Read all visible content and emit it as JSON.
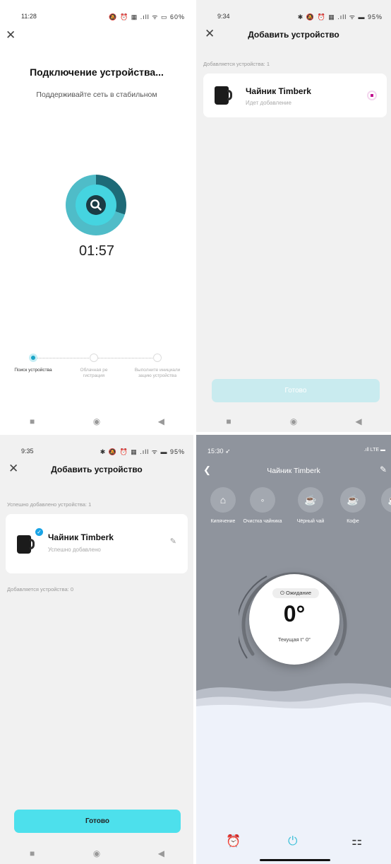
{
  "panel1": {
    "time": "11:28",
    "status_icons": "🔕 ⏰ ▦ .ıll ᯤ ▭ 60%",
    "title": "Подключение устройства...",
    "subtitle": "Поддерживайте сеть в стабильном",
    "timer": "01:57",
    "steps": [
      {
        "label": "Поиск устройства",
        "active": true
      },
      {
        "label": "Облачная ре гистрация",
        "active": false
      },
      {
        "label": "Выполните инициали зацию устройства",
        "active": false
      }
    ],
    "nav": [
      "■",
      "◉",
      "◀"
    ]
  },
  "panel2": {
    "time": "9:34",
    "status_icons": "✱ 🔕 ⏰ ▦ .ıll ᯤ ▬ 95%",
    "header": "Добавить устройство",
    "adding_label": "Добавляется устройства: 1",
    "device_name": "Чайник Timberk",
    "device_state": "Идет добавление",
    "done_button": "Готово",
    "nav": [
      "■",
      "◉",
      "◀"
    ]
  },
  "panel3": {
    "time": "9:35",
    "status_icons": "✱ 🔕 ⏰ ▦ .ıll ᯤ ▬ 95%",
    "header": "Добавить устройство",
    "success_label": "Успешно добавлено устройства: 1",
    "device_name": "Чайник Timberk",
    "device_state": "Успешно добавлено",
    "adding_label": "Добавляется устройства: 0",
    "done_button": "Готово",
    "nav": [
      "■",
      "◉",
      "◀"
    ]
  },
  "panel4": {
    "time": "15:30 ➶",
    "status_icons": ".ıll LTE ▬",
    "device_name": "Чайник Timberk",
    "modes": [
      {
        "label": "Кипячение",
        "icon": "kettle-icon",
        "glyph": "⌂"
      },
      {
        "label": "Очистка чайника",
        "icon": "clean-icon",
        "glyph": "◦"
      },
      {
        "label": "Чёрный чай",
        "icon": "black-tea-icon",
        "glyph": "☕"
      },
      {
        "label": "Кофе",
        "icon": "coffee-icon",
        "glyph": "☕"
      },
      {
        "label": "Зе",
        "icon": "green-tea-icon",
        "glyph": "☕"
      }
    ],
    "state_label": "⏻ Ожидание",
    "temperature": "0°",
    "current_temp": "Текущая t° 0°",
    "bottom_icons": [
      "alarm-icon",
      "power-icon",
      "apps-icon"
    ],
    "accent": "#41c1d9"
  }
}
